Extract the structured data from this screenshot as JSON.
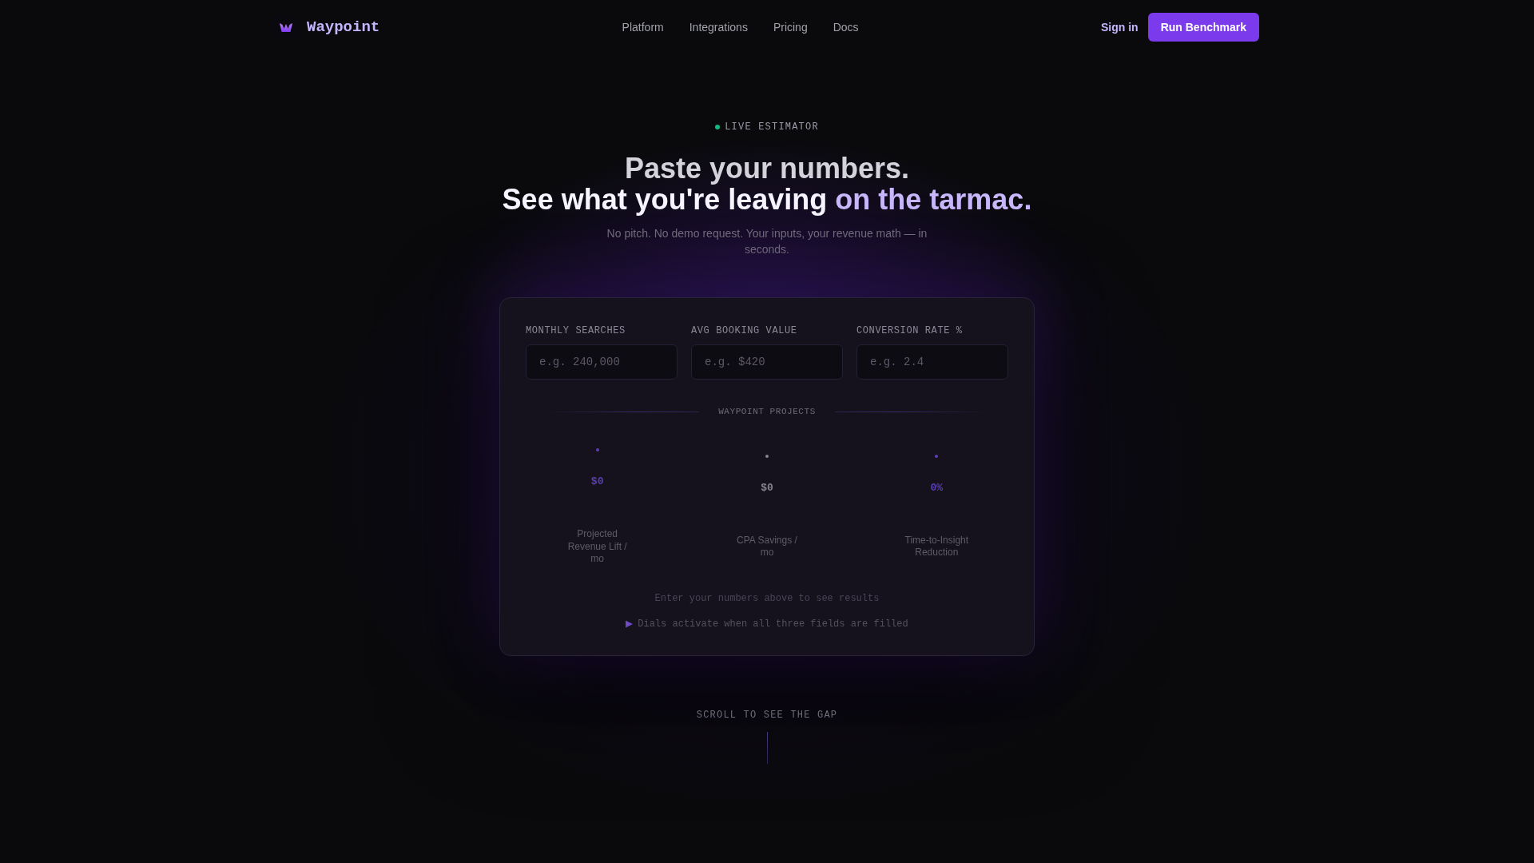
{
  "brand": {
    "name": "Waypoint"
  },
  "nav": {
    "links": [
      "Platform",
      "Integrations",
      "Pricing",
      "Docs"
    ],
    "sign_in": "Sign in",
    "cta": "Run Benchmark"
  },
  "hero": {
    "eyebrow": "LIVE ESTIMATOR",
    "heading": {
      "lines": [
        "Paste your numbers.",
        "See what you're leaving"
      ],
      "accent": "on the tarmac."
    },
    "subtitle": "No pitch. No demo request. Your inputs, your revenue math — in seconds."
  },
  "estimator": {
    "fields": [
      {
        "label": "MONTHLY SEARCHES",
        "placeholder": "e.g. 240,000"
      },
      {
        "label": "AVG BOOKING VALUE",
        "placeholder": "e.g. $420"
      },
      {
        "label": "CONVERSION RATE %",
        "placeholder": "e.g. 2.4"
      }
    ],
    "section_label": "WAYPOINT PROJECTS",
    "dials": [
      {
        "label": "Projected Revenue Lift / mo",
        "value": "$0",
        "color": "#5b3fb5"
      },
      {
        "label": "CPA Savings / mo",
        "value": "$0",
        "color": "#8a8594"
      },
      {
        "label": "Time-to-Insight Reduction",
        "value": "0%",
        "color": "#5b3fb5"
      }
    ],
    "empty_message": "Enter your numbers above to see results",
    "note": "Dials activate when all three fields are filled"
  },
  "scroll_hint": "SCROLL TO SEE THE GAP"
}
